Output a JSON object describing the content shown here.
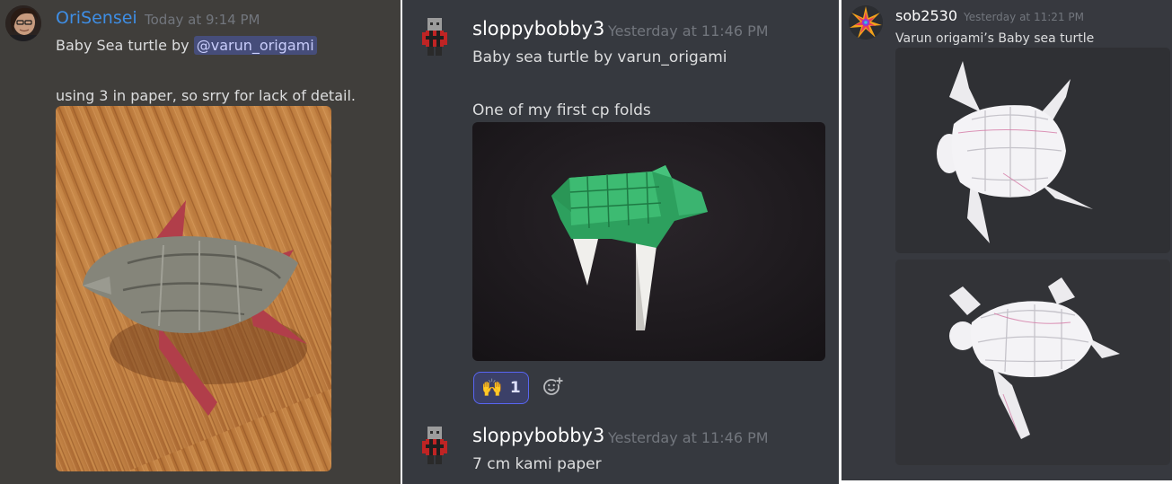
{
  "panel_a": {
    "author": {
      "username": "OriSensei",
      "timestamp": "Today at 9:14 PM",
      "avatar_icon": "user-avatar-photo",
      "name_color": "#3e8ee5"
    },
    "message": {
      "line1_text": "Baby Sea turtle by ",
      "mention": "@varun_origami",
      "line2_text": "using 3 in paper, so srry for lack of detail."
    },
    "attachment": {
      "image_icon": "origami-gray-sea-turtle-photo"
    }
  },
  "panel_b": {
    "messages": [
      {
        "username": "sloppybobby3",
        "timestamp": "Yesterday at 11:46 PM",
        "avatar_icon": "pixel-character-avatar",
        "line1_text": "Baby sea turtle by varun_origami",
        "line2_text": "One of my first cp folds",
        "attachment_icon": "origami-green-sea-turtle-photo",
        "reaction": {
          "emoji": "🙌",
          "count": "1"
        },
        "add_reaction_icon": "add-reaction-icon"
      },
      {
        "username": "sloppybobby3",
        "timestamp": "Yesterday at 11:46 PM",
        "avatar_icon": "pixel-character-avatar",
        "line1_text": "7 cm kami paper"
      }
    ]
  },
  "panel_c": {
    "author": {
      "username": "sob2530",
      "timestamp": "Yesterday at 11:21 PM",
      "avatar_icon": "colorful-starburst-avatar"
    },
    "message": {
      "line1_text": "Varun origami’s  Baby sea turtle"
    },
    "attachments": [
      {
        "image_icon": "origami-white-sea-turtle-top-photo"
      },
      {
        "image_icon": "origami-white-sea-turtle-angled-photo"
      }
    ]
  },
  "colors": {
    "panel_a_bg": "#403e3b",
    "panel_b_bg": "#36393f",
    "panel_c_bg": "#37393f",
    "timestamp": "#72767d",
    "message_text": "#dcddde",
    "mention_bg": "#464d7a",
    "reaction_border": "#5865f2"
  }
}
